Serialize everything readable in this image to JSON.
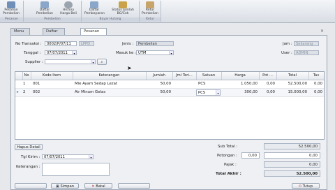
{
  "ribbon": {
    "groups": [
      {
        "caption": "Pesanan",
        "buttons": [
          {
            "label1": "Pesanan",
            "label2": "Pembelian"
          }
        ]
      },
      {
        "caption": "Pembelian",
        "buttons": [
          {
            "label1": "Daftar",
            "label2": "Pembelian"
          },
          {
            "label1": "History",
            "label2": "Harga Beli"
          }
        ]
      },
      {
        "caption": "Bayar Hutang",
        "buttons": [
          {
            "label1": "Daftar",
            "label2": "Pembayaran"
          },
          {
            "label1": "Status Jumlah",
            "label2": "BG/Cek"
          }
        ]
      },
      {
        "caption": "Retur",
        "buttons": [
          {
            "label1": "Retur",
            "label2": "Pembelian"
          }
        ]
      }
    ]
  },
  "tabs": [
    "Menu Utama",
    "Daftar Pesanan",
    "Pesanan Pembelian"
  ],
  "form": {
    "no_transaksi_label": "No Transaksi :",
    "no_transaksi_value": "0002/P/07/11",
    "auto_button": "LPPD",
    "tanggal_label": "Tanggal :",
    "tanggal_value": "07/07/2011",
    "supplier_label": "Supplier :",
    "supplier_value": "",
    "jenis_label": "Jenis :",
    "jenis_value": "Pembelian",
    "masuk_ke_label": "Masuk ke :",
    "masuk_ke_value": "UTM",
    "jam_label": "Jam :",
    "jam_value": "Sekarang",
    "user_label": "User :",
    "user_value": "ADMIN"
  },
  "grid": {
    "headers": [
      "No",
      "Kode Item",
      "Keterangan",
      "Jumlah",
      "Jml Teri...",
      "Satuan",
      "Harga",
      "Pot ...",
      "Total",
      "Tav"
    ],
    "rows": [
      [
        "1",
        "001",
        "Mie Ayam Sedap Lezat",
        "50,00",
        "",
        "PCS",
        "1.050,00",
        "0,00",
        "52.500,00",
        "0,00"
      ],
      [
        "2",
        "002",
        "Air Minum Gelas",
        "50,00",
        "",
        "PCS",
        "300,00",
        "0,00",
        "15.000,00",
        "0,00"
      ]
    ]
  },
  "footer": {
    "hapus_detail": "Hapus Detail",
    "tgl_kirim_label": "Tgl Kirim :",
    "tgl_kirim_value": "07/07/2011",
    "keterangan_label": "Keterangan :",
    "sub_total_label": "Sub Total :",
    "sub_total_value": "52.500,00",
    "potongan_label": "Potongan :",
    "potongan_pct": "0,00",
    "potongan_value": "0,00",
    "pajak_label": "Pajak :",
    "pajak_value": "0,00",
    "total_akhir_label": "Total Akhir :",
    "total_akhir_value": "52.500,00",
    "simpan": "Simpan",
    "batal": "Batal",
    "tutup": "Tutup"
  }
}
